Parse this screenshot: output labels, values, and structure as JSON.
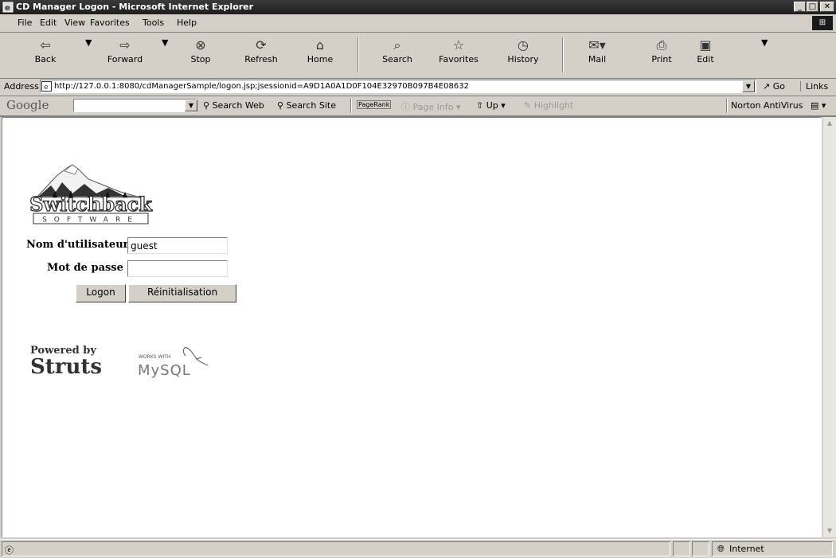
{
  "window": {
    "title": "CD Manager Logon - Microsoft Internet Explorer"
  },
  "menu": [
    "File",
    "Edit",
    "View",
    "Favorites",
    "Tools",
    "Help"
  ],
  "toolbar": {
    "back": "Back",
    "forward": "Forward",
    "stop": "Stop",
    "refresh": "Refresh",
    "home": "Home",
    "search": "Search",
    "favorites": "Favorites",
    "history": "History",
    "mail": "Mail",
    "print": "Print",
    "edit": "Edit"
  },
  "address": {
    "label": "Address",
    "url": "http://127.0.0.1:8080/cdManagerSample/logon.jsp;jsessionid=A9D1A0A1D0F104E32970B097B4E08632",
    "go": "Go",
    "links": "Links"
  },
  "google": {
    "logo": "Google",
    "search_web": "Search Web",
    "search_site": "Search Site",
    "pagerank": "PageRank",
    "page_info": "Page Info",
    "up": "Up",
    "highlight": "Highlight",
    "norton": "Norton AntiVirus"
  },
  "page": {
    "logo_main": "Switchback",
    "logo_sub": "SOFTWARE",
    "username_label": "Nom d'utilisateur",
    "username_value": "guest",
    "password_label": "Mot de passe",
    "password_value": "",
    "logon_button": "Logon",
    "reset_button": "Réinitialisation",
    "powered_by": "Powered by",
    "struts": "Struts",
    "works_with": "WORKS WITH",
    "mysql": "MySQL"
  },
  "status": {
    "zone": "Internet"
  }
}
